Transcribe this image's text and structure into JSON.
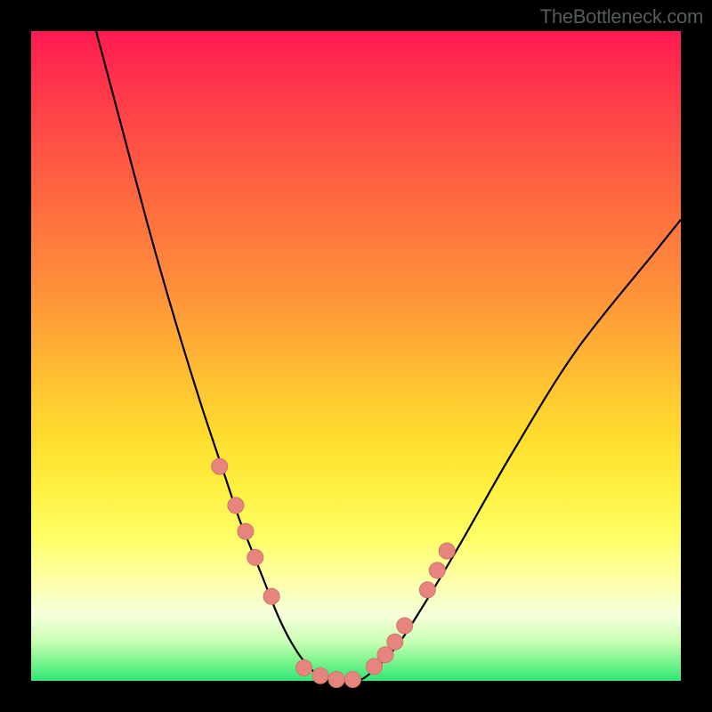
{
  "attribution": "TheBottleneck.com",
  "colors": {
    "curve": "#000000",
    "marker_fill": "#e5857e",
    "marker_stroke": "#d4736c"
  },
  "chart_data": {
    "type": "line",
    "title": "",
    "xlabel": "",
    "ylabel": "",
    "xlim": [
      0,
      100
    ],
    "ylim": [
      0,
      100
    ],
    "curve": {
      "x": [
        10,
        14,
        18,
        22,
        26,
        30,
        32,
        34,
        36,
        38,
        40,
        42,
        44,
        46,
        48,
        50,
        52,
        56,
        60,
        66,
        74,
        84,
        96,
        100
      ],
      "y": [
        100,
        85,
        70,
        56,
        43,
        31,
        25,
        20,
        15,
        10,
        6,
        3,
        1,
        0,
        0,
        0,
        1,
        5,
        11,
        21,
        35,
        51,
        66,
        71
      ]
    },
    "markers": {
      "x": [
        29,
        31.5,
        33,
        34.5,
        37,
        42,
        44.5,
        47,
        49.5,
        52.8,
        54.5,
        56,
        57.5,
        61,
        62.5,
        64
      ],
      "y": [
        33,
        27,
        23,
        19,
        13,
        2,
        0.8,
        0.2,
        0.2,
        2.2,
        4,
        6,
        8.5,
        14,
        17,
        20
      ]
    }
  }
}
